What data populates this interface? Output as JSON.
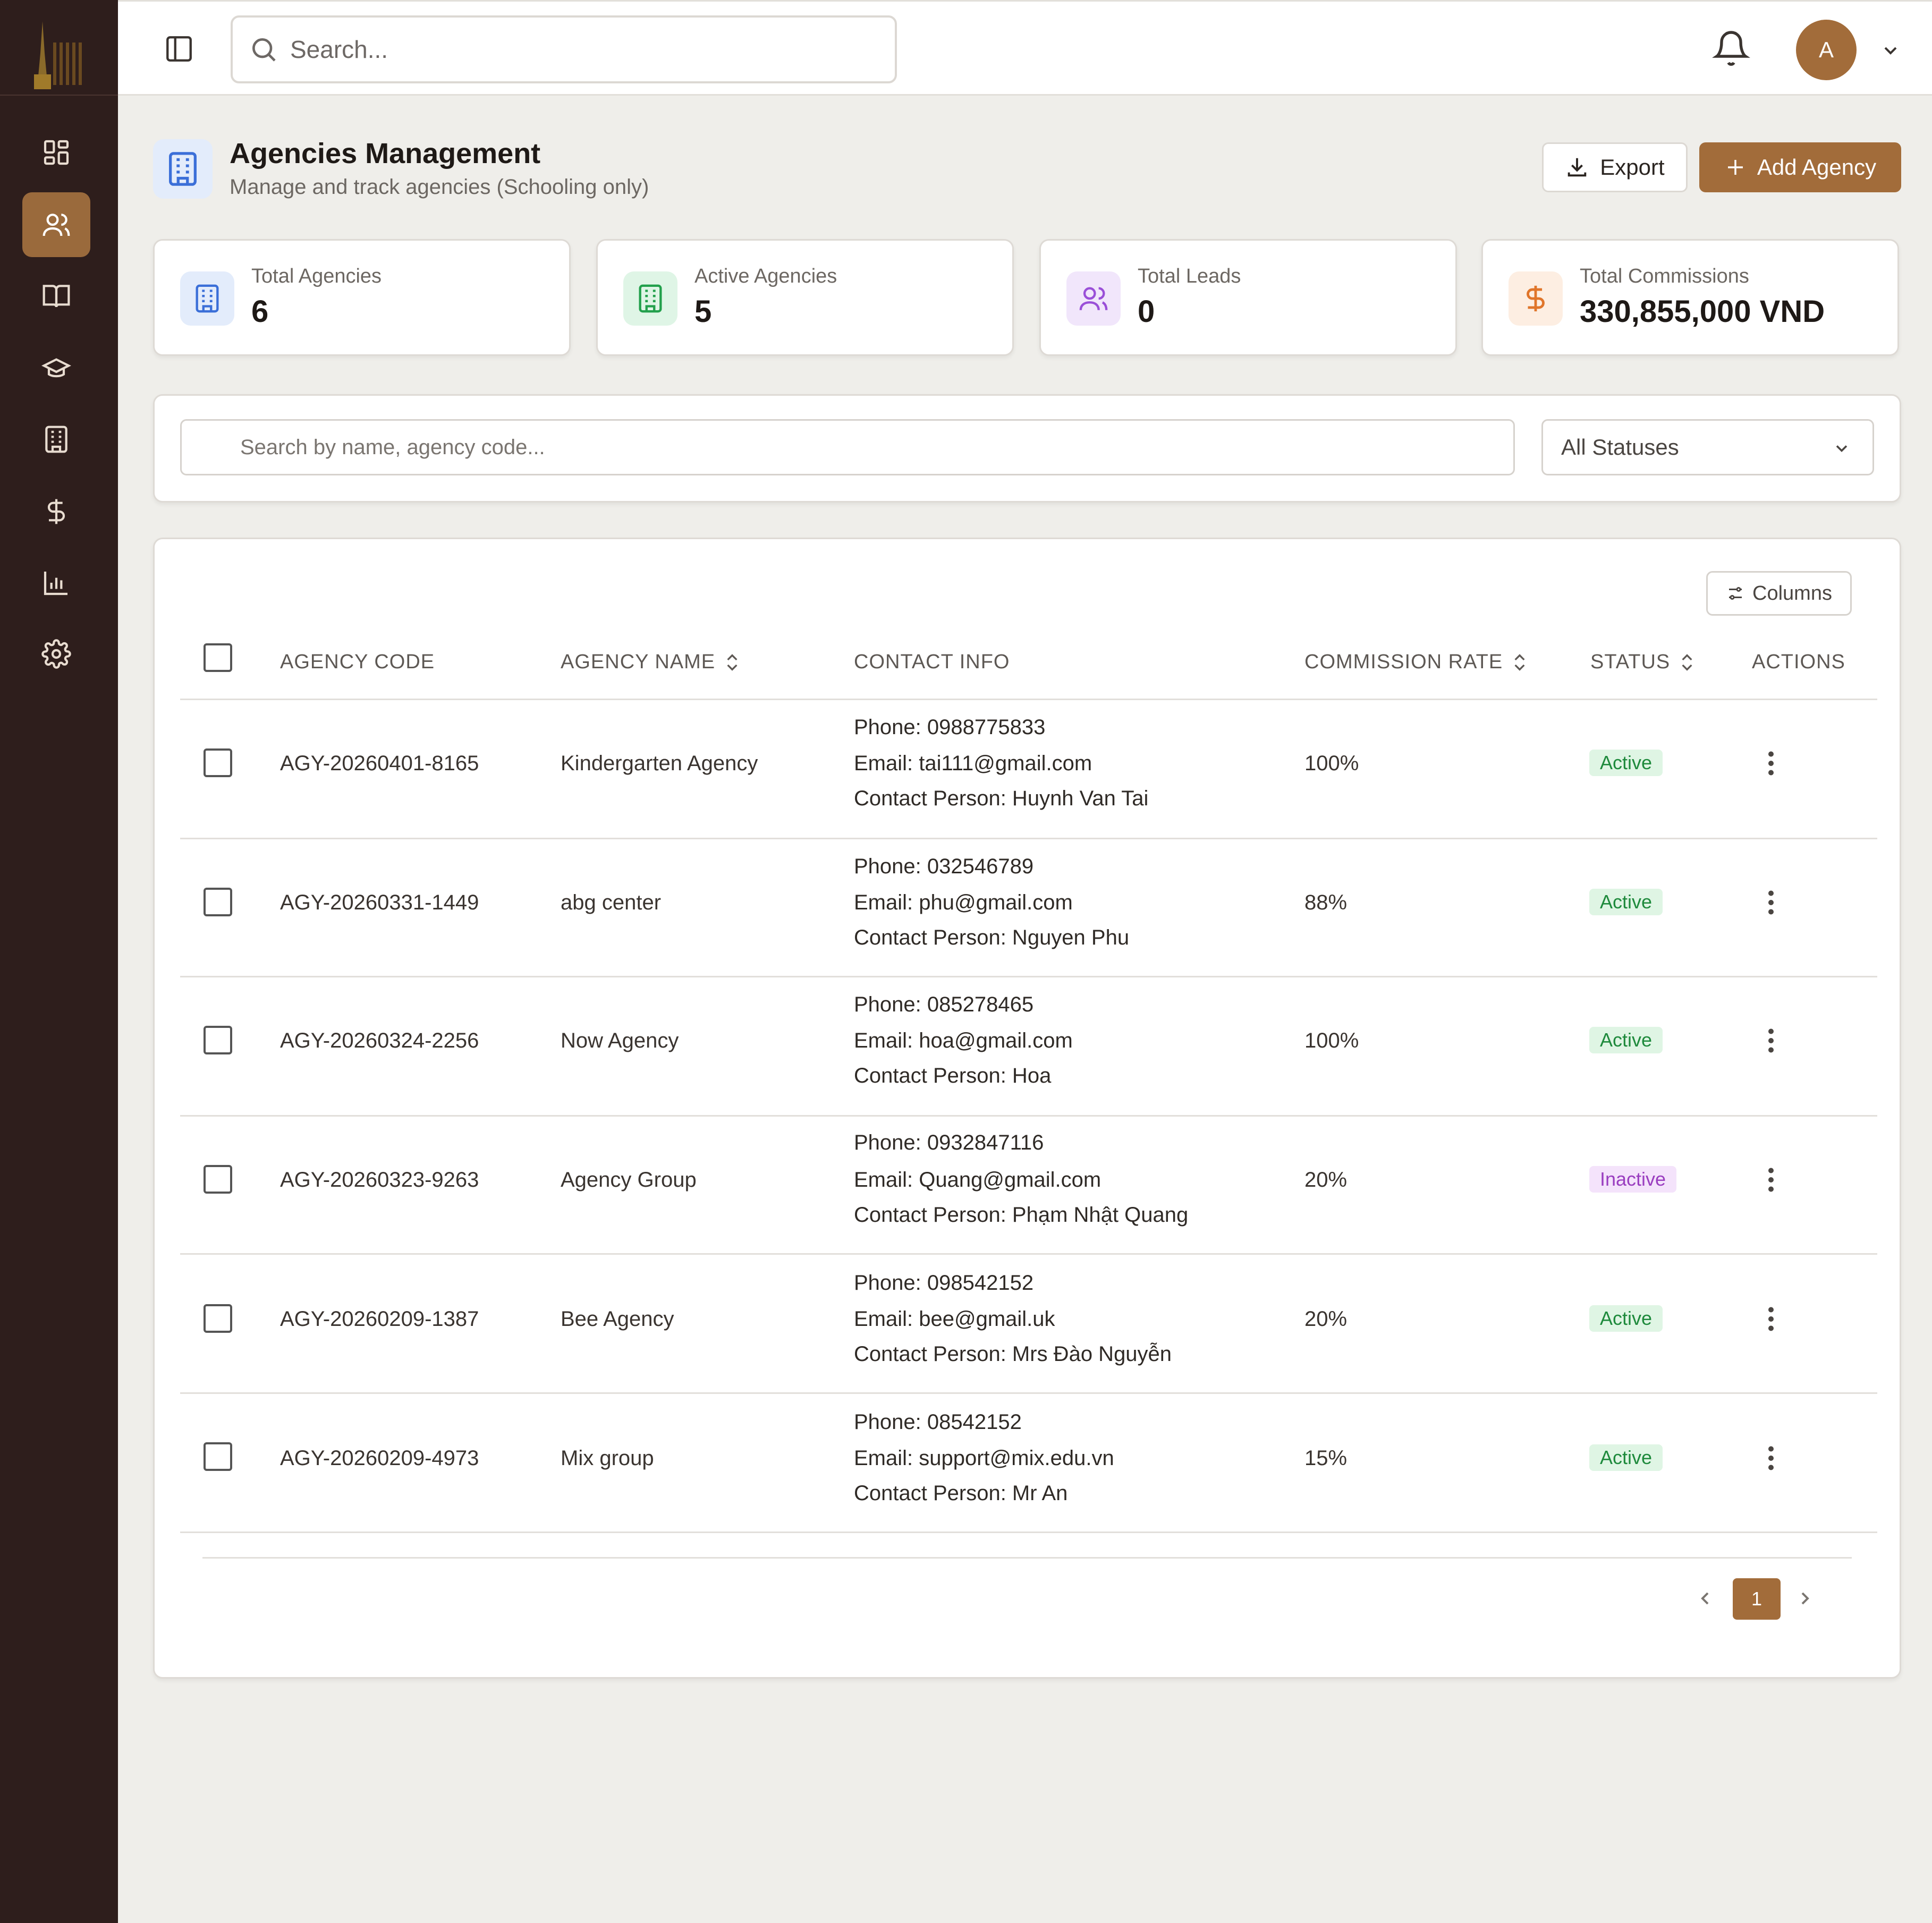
{
  "header": {
    "search_placeholder": "Search...",
    "avatar_initial": "A"
  },
  "page": {
    "title": "Agencies Management",
    "subtitle": "Manage and track agencies (Schooling only)",
    "export_label": "Export",
    "add_label": "Add Agency"
  },
  "stats": [
    {
      "label": "Total Agencies",
      "value": "6",
      "color": "#3b6fd8",
      "bg": "#e3ecfb"
    },
    {
      "label": "Active Agencies",
      "value": "5",
      "color": "#23a04c",
      "bg": "#dff5e6"
    },
    {
      "label": "Total Leads",
      "value": "0",
      "color": "#9a4fd8",
      "bg": "#f1e6fb"
    },
    {
      "label": "Total Commissions",
      "value": "330,855,000 VND",
      "color": "#e0752a",
      "bg": "#fdeee2"
    }
  ],
  "filters": {
    "search_placeholder": "Search by name, agency code...",
    "status_selected": "All Statuses"
  },
  "table": {
    "columns_button": "Columns",
    "headers": {
      "code": "AGENCY CODE",
      "name": "AGENCY NAME",
      "contact": "CONTACT INFO",
      "commission": "COMMISSION RATE",
      "status": "STATUS",
      "actions": "ACTIONS"
    },
    "rows": [
      {
        "code": "AGY-20260401-8165",
        "name": "Kindergarten Agency",
        "phone": "Phone: 0988775833",
        "email": "Email: tai111@gmail.com",
        "contact": "Contact Person: Huynh Van Tai",
        "commission": "100%",
        "status": "Active"
      },
      {
        "code": "AGY-20260331-1449",
        "name": "abg center",
        "phone": "Phone: 032546789",
        "email": "Email: phu@gmail.com",
        "contact": "Contact Person: Nguyen Phu",
        "commission": "88%",
        "status": "Active"
      },
      {
        "code": "AGY-20260324-2256",
        "name": "Now Agency",
        "phone": "Phone: 085278465",
        "email": "Email: hoa@gmail.com",
        "contact": "Contact Person: Hoa",
        "commission": "100%",
        "status": "Active"
      },
      {
        "code": "AGY-20260323-9263",
        "name": "Agency Group",
        "phone": "Phone: 0932847116",
        "email": "Email: Quang@gmail.com",
        "contact": "Contact Person: Phạm Nhật Quang",
        "commission": "20%",
        "status": "Inactive"
      },
      {
        "code": "AGY-20260209-1387",
        "name": "Bee Agency",
        "phone": "Phone: 098542152",
        "email": "Email: bee@gmail.uk",
        "contact": "Contact Person: Mrs Đào Nguyễn",
        "commission": "20%",
        "status": "Active"
      },
      {
        "code": "AGY-20260209-4973",
        "name": "Mix group",
        "phone": "Phone: 08542152",
        "email": "Email: support@mix.edu.vn",
        "contact": "Contact Person: Mr An",
        "commission": "15%",
        "status": "Active"
      }
    ]
  },
  "pagination": {
    "current_page": "1"
  },
  "colors": {
    "sidebar": "#2e1e1c",
    "accent": "#a26c3a",
    "active_badge": "#1e8a3c",
    "inactive_badge": "#9a3ec0"
  }
}
